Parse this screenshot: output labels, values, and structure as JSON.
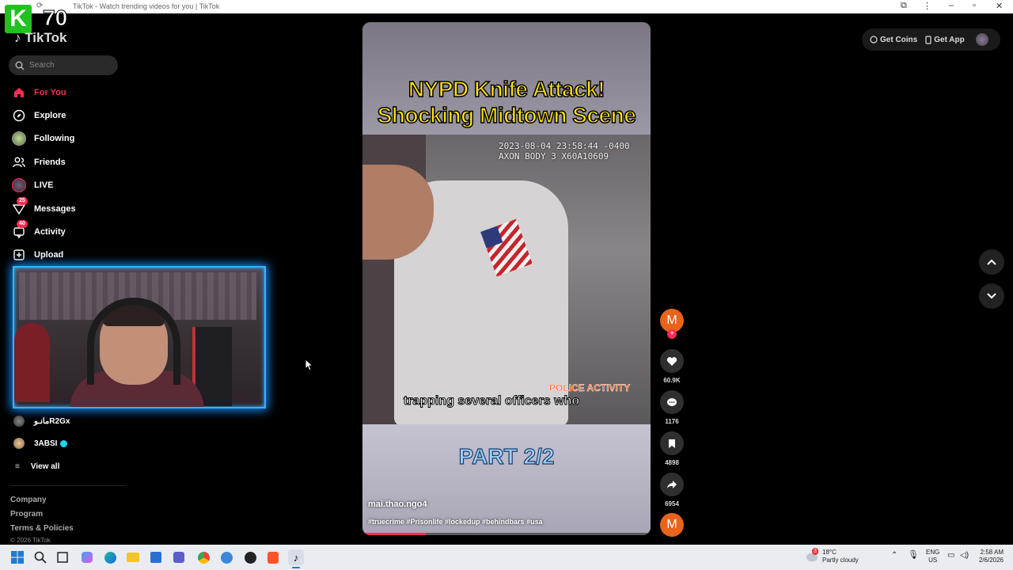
{
  "window": {
    "title": "TikTok - Watch trending videos for you | TikTok"
  },
  "overlay_badge": {
    "letter": "K",
    "number": "70"
  },
  "logo": {
    "text": "TikTok"
  },
  "search": {
    "placeholder": "Search"
  },
  "nav": [
    {
      "label": "For You",
      "icon": "home-icon",
      "active": true
    },
    {
      "label": "Explore",
      "icon": "compass-icon"
    },
    {
      "label": "Following",
      "icon": "following-avatar"
    },
    {
      "label": "Friends",
      "icon": "friends-icon"
    },
    {
      "label": "LIVE",
      "icon": "live-icon"
    },
    {
      "label": "Messages",
      "icon": "messages-icon",
      "badge": "25"
    },
    {
      "label": "Activity",
      "icon": "activity-icon",
      "badge": "40"
    },
    {
      "label": "Upload",
      "icon": "upload-icon"
    }
  ],
  "following_accounts": [
    {
      "name": "مانـوR2Gx"
    },
    {
      "name": "3ABSI",
      "verified": true
    }
  ],
  "view_all": "View all",
  "footer": {
    "links": [
      "Company",
      "Program",
      "Terms & Policies"
    ],
    "copyright": "© 2026 TikTok"
  },
  "video": {
    "title_line1": "NYPD Knife Attack!",
    "title_line2": "Shocking Midtown Scene",
    "timestamp_line1": "2023-08-04 23:58:44 -0400",
    "timestamp_line2": "AXON BODY 3 X60A10609",
    "watermark": "POLICE ACTIVITY",
    "subtitle": "trapping several officers who",
    "part": "PART 2/2",
    "author": "mai.thao.ngo4",
    "hashtags": "#truecrime #Prisonlife #lockedup #behindbars #usa",
    "progress": 0.22
  },
  "actions": {
    "avatar_letter": "M",
    "likes": "60.9K",
    "comments": "1176",
    "saves": "4898",
    "shares": "6954"
  },
  "topbar": {
    "coins": "Get Coins",
    "app": "Get App"
  },
  "taskbar": {
    "weather_temp": "18°C",
    "weather_desc": "Partly cloudy",
    "weather_badge": "3",
    "lang1": "ENG",
    "lang2": "US",
    "time": "2:58 AM",
    "date": "2/6/2026"
  },
  "colors": {
    "accent": "#fe2c55",
    "title_yellow": "#ffe400",
    "webcam_border": "#2fb6ff"
  }
}
